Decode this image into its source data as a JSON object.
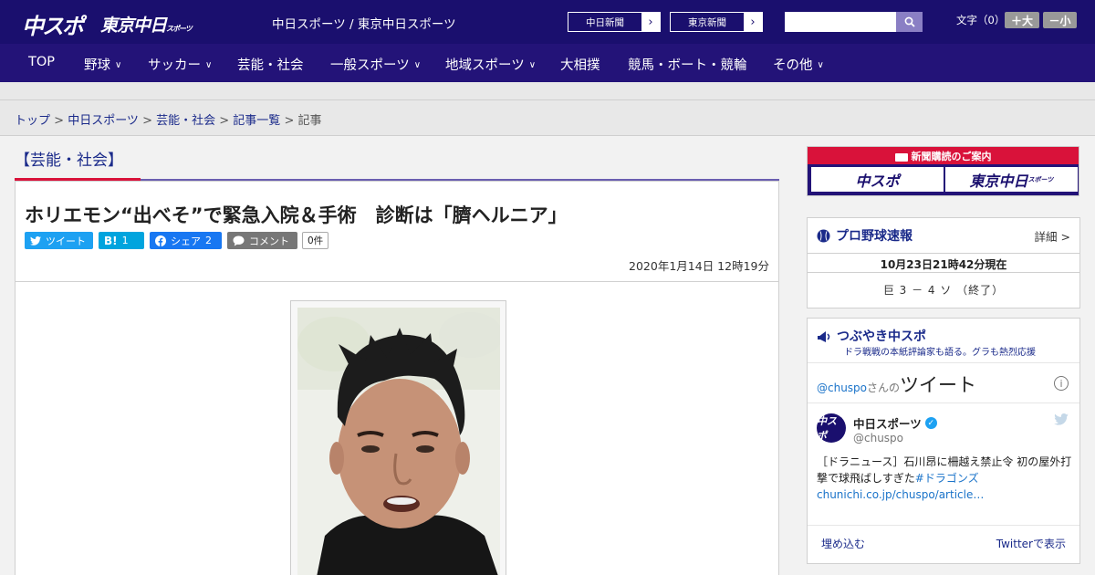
{
  "header": {
    "logo_chuspo": "中スポ",
    "logo_tokyo": "東京中日",
    "logo_tokyo_sub": "スポーツ",
    "sites_text": "中日スポーツ / 東京中日スポーツ",
    "ext_links": [
      {
        "label": "中日新聞",
        "arrow": "›"
      },
      {
        "label": "東京新聞",
        "arrow": "›"
      }
    ],
    "search_placeholder": "",
    "fontsize_label": "文字（0）",
    "fontsize_plus": "＋大",
    "fontsize_minus": "－小"
  },
  "nav": {
    "items": [
      {
        "label": "TOP",
        "has_menu": false
      },
      {
        "label": "野球",
        "has_menu": true
      },
      {
        "label": "サッカー",
        "has_menu": true
      },
      {
        "label": "芸能・社会",
        "has_menu": false
      },
      {
        "label": "一般スポーツ",
        "has_menu": true
      },
      {
        "label": "地域スポーツ",
        "has_menu": true
      },
      {
        "label": "大相撲",
        "has_menu": false
      },
      {
        "label": "競馬・ボート・競輪",
        "has_menu": false
      },
      {
        "label": "その他",
        "has_menu": true
      }
    ],
    "chevron": "∨"
  },
  "breadcrumb": {
    "items": [
      "トップ",
      "中日スポーツ",
      "芸能・社会",
      "記事一覧"
    ],
    "current": "記事",
    "sep": " > "
  },
  "article": {
    "category": "【芸能・社会】",
    "headline": "ホリエモン“出べそ”で緊急入院＆手術　診断は「臍ヘルニア」",
    "share": {
      "twitter": "ツイート",
      "hatena_icon": "B!",
      "hatena_count": "1",
      "facebook": "シェア",
      "facebook_count": "2",
      "comment": "コメント",
      "comment_count": "0件"
    },
    "date": "2020年1月14日 12時19分"
  },
  "sidebar": {
    "subscription": {
      "title": "新聞購読のご案内",
      "chuspo": "中スポ",
      "tokyo": "東京中日",
      "tokyo_sub": "スポーツ"
    },
    "baseball": {
      "title": "プロ野球速報",
      "more": "詳細 >",
      "time": "10月23日21時42分現在",
      "score": "巨 3 － 4 ソ （終了）"
    },
    "tweets": {
      "title": "つぶやき中スポ",
      "subtitle": "ドラ戦戦の本紙評論家も語る。グラも熱烈応援",
      "handle": "@chuspo",
      "header_mid": "さんの",
      "header_big": "ツイート",
      "info": "i",
      "avatar": "中スポ",
      "name": "中日スポーツ",
      "user": "@chuspo",
      "text_body": "［ドラニュース］石川昂に柵越え禁止令 初の屋外打撃で球飛ばしすぎた",
      "hashtag": "#ドラゴンズ",
      "url": "chunichi.co.jp/chuspo/article…",
      "embed": "埋め込む",
      "view_on": "Twitterで表示"
    }
  },
  "colors": {
    "header_navy": "#1a0f6e",
    "nav_navy": "#231378",
    "accent_red": "#d9123a",
    "link_blue": "#1a2a8a"
  }
}
